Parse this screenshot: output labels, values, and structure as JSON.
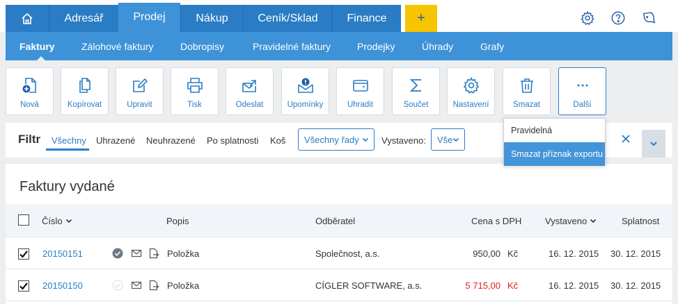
{
  "nav": {
    "tabs": [
      {
        "label": "Adresář",
        "active": false
      },
      {
        "label": "Prodej",
        "active": true
      },
      {
        "label": "Nákup",
        "active": false
      },
      {
        "label": "Ceník/Sklad",
        "active": false
      },
      {
        "label": "Finance",
        "active": false
      }
    ],
    "plus_label": "+",
    "icons": [
      "home-icon",
      "gear-icon",
      "help-icon",
      "notification-icon"
    ]
  },
  "subnav": {
    "items": [
      {
        "label": "Faktury",
        "active": true
      },
      {
        "label": "Zálohové faktury",
        "active": false
      },
      {
        "label": "Dobropisy",
        "active": false
      },
      {
        "label": "Pravidelné faktury",
        "active": false
      },
      {
        "label": "Prodejky",
        "active": false
      },
      {
        "label": "Úhrady",
        "active": false
      },
      {
        "label": "Grafy",
        "active": false
      }
    ]
  },
  "toolbar": {
    "buttons": [
      {
        "label": "Nová",
        "icon": "new-document-icon"
      },
      {
        "label": "Kopírovat",
        "icon": "copy-icon"
      },
      {
        "label": "Upravit",
        "icon": "edit-icon"
      },
      {
        "label": "Tisk",
        "icon": "print-icon"
      },
      {
        "label": "Odeslat",
        "icon": "send-icon"
      },
      {
        "label": "Upomínky",
        "icon": "reminder-icon"
      },
      {
        "label": "Uhradit",
        "icon": "wallet-icon"
      },
      {
        "label": "Součet",
        "icon": "sum-icon"
      },
      {
        "label": "Nastavení",
        "icon": "settings-icon"
      },
      {
        "label": "Smazat",
        "icon": "trash-icon"
      },
      {
        "label": "Další",
        "icon": "more-icon",
        "selected": true
      }
    ]
  },
  "dropdown": {
    "items": [
      {
        "label": "Pravidelná",
        "hover": false
      },
      {
        "label": "Smazat příznak exportu",
        "hover": true
      }
    ]
  },
  "filter": {
    "label": "Filtr",
    "tabs": [
      {
        "label": "Všechny",
        "active": true
      },
      {
        "label": "Uhrazené",
        "active": false
      },
      {
        "label": "Neuhrazené",
        "active": false
      },
      {
        "label": "Po splatnosti",
        "active": false
      },
      {
        "label": "Koš",
        "active": false
      }
    ],
    "series_select": "Všechny řady",
    "issued_label": "Vystaveno:",
    "issued_select": "Vše"
  },
  "content": {
    "title": "Faktury vydané",
    "columns": {
      "number": "Číslo",
      "description": "Popis",
      "customer": "Odběratel",
      "price": "Cena s DPH",
      "issued": "Vystaveno",
      "due": "Splatnost"
    },
    "rows": [
      {
        "checked": true,
        "number": "20150151",
        "paid": true,
        "description": "Položka",
        "customer": "Společnost, a.s.",
        "amount": "950,00",
        "currency": "Kč",
        "overdue": false,
        "issued": "16. 12. 2015",
        "due": "30. 12. 2015"
      },
      {
        "checked": true,
        "number": "20150150",
        "paid": false,
        "description": "Položka",
        "customer": "CÍGLER SOFTWARE, a.s.",
        "amount": "5 715,00",
        "currency": "Kč",
        "overdue": true,
        "issued": "16. 12. 2015",
        "due": "30. 12. 2015"
      }
    ]
  },
  "colors": {
    "primary": "#2a7cc5",
    "secondary": "#3d92d8",
    "accent": "#f6c400",
    "danger": "#e02020"
  }
}
